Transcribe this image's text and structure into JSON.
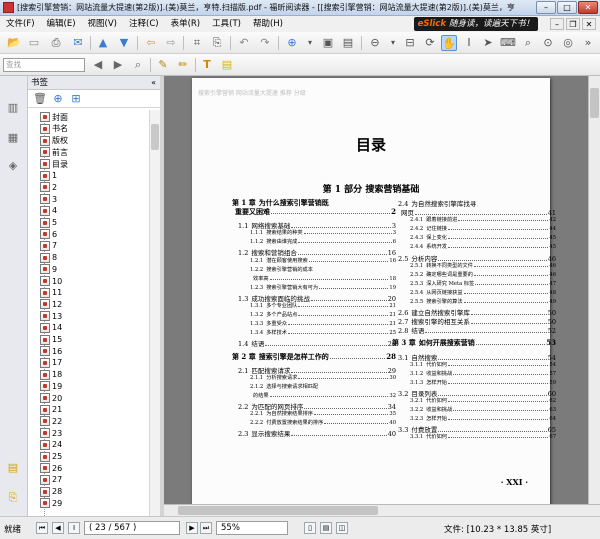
{
  "window": {
    "title": "[搜索引擎营销：网站流量大提速(第2版)].(美)莫兰，亨特.扫描版.pdf - 福昕阅读器 - [[搜索引擎营销：网站流量大提速(第2版)].(美)莫兰，亨",
    "minimize": "–",
    "maximize": "□",
    "close": "✕"
  },
  "menu": {
    "items": [
      "文件(F)",
      "编辑(E)",
      "视图(V)",
      "注释(C)",
      "表单(R)",
      "工具(T)",
      "帮助(H)"
    ],
    "promo_brand": "eSlick",
    "promo_text": "随身读，读遍天下书！"
  },
  "toolbar2": {
    "search_placeholder": "查找"
  },
  "panel": {
    "title": "书签",
    "collapse": "«",
    "bookmarks": [
      "封面",
      "书名",
      "版权",
      "前言",
      "目录",
      "1",
      "2",
      "3",
      "4",
      "5",
      "6",
      "7",
      "8",
      "9",
      "10",
      "11",
      "12",
      "13",
      "14",
      "15",
      "16",
      "17",
      "18",
      "19",
      "20",
      "21",
      "22",
      "23",
      "24",
      "25",
      "26",
      "27",
      "28",
      "29"
    ]
  },
  "document": {
    "bleed_text": "搜索引擎营销    网站流量大提速              推荐    分级",
    "toc_title": "目录",
    "part_title": "第 1 部分    搜索营销基础",
    "page_number": "· XXI ·",
    "left_column": [
      {
        "lv": 1,
        "num": "第 1 章",
        "text": "为什么搜索引擎营销既",
        "page": ""
      },
      {
        "lv": 1,
        "num": "",
        "text": "重要又困难",
        "page": "2"
      },
      {
        "lv": 0
      },
      {
        "lv": 2,
        "num": "1.1",
        "text": "网络搜索基础",
        "page": "3"
      },
      {
        "lv": 3,
        "num": "1.1.1",
        "text": "搜索结果的种类",
        "page": "3"
      },
      {
        "lv": 3,
        "num": "1.1.2",
        "text": "搜索由谁完成",
        "page": "6"
      },
      {
        "lv": 2,
        "num": "1.2",
        "text": "搜索和营销组合",
        "page": "16"
      },
      {
        "lv": 3,
        "num": "1.2.1",
        "text": "潜在顾客使用搜索",
        "page": "16"
      },
      {
        "lv": 3,
        "num": "1.2.2",
        "text": "搜索引擎营销的成本",
        "page": ""
      },
      {
        "lv": 3,
        "num": "",
        "text": "效率高",
        "page": "18"
      },
      {
        "lv": 3,
        "num": "1.2.3",
        "text": "搜索引擎营销大有可为",
        "page": "19"
      },
      {
        "lv": 2,
        "num": "1.3",
        "text": "成功搜索面临的挑战",
        "page": "20"
      },
      {
        "lv": 3,
        "num": "1.3.1",
        "text": "多个专业团队",
        "page": "21"
      },
      {
        "lv": 3,
        "num": "1.3.2",
        "text": "多个产品站点",
        "page": "21"
      },
      {
        "lv": 3,
        "num": "1.3.3",
        "text": "多重受众",
        "page": "21"
      },
      {
        "lv": 3,
        "num": "1.3.4",
        "text": "多样技术",
        "page": "25"
      },
      {
        "lv": 2,
        "num": "1.4",
        "text": "结语",
        "page": "26"
      },
      {
        "lv": 0
      },
      {
        "lv": 1,
        "num": "第 2 章",
        "text": "搜索引擎是怎样工作的",
        "page": "28"
      },
      {
        "lv": 0
      },
      {
        "lv": 2,
        "num": "2.1",
        "text": "匹配搜索请求",
        "page": "29"
      },
      {
        "lv": 3,
        "num": "2.1.1",
        "text": "分析搜索请求",
        "page": "30"
      },
      {
        "lv": 3,
        "num": "2.1.2",
        "text": "选择与搜索请求相匹配",
        "page": ""
      },
      {
        "lv": 3,
        "num": "",
        "text": "的结果",
        "page": "32"
      },
      {
        "lv": 2,
        "num": "2.2",
        "text": "为匹配的网页排序",
        "page": "34"
      },
      {
        "lv": 3,
        "num": "2.2.1",
        "text": "为自然搜索结果排序",
        "page": "35"
      },
      {
        "lv": 3,
        "num": "2.2.2",
        "text": "付费放置搜索结果的排序",
        "page": "40"
      },
      {
        "lv": 2,
        "num": "2.3",
        "text": "显示搜索结果",
        "page": "40"
      }
    ],
    "right_column": [
      {
        "lv": 2,
        "num": "2.4",
        "text": "为自然搜索引擎库找寻",
        "page": ""
      },
      {
        "lv": 2,
        "num": "",
        "text": "网页",
        "page": "41"
      },
      {
        "lv": 3,
        "num": "2.4.1",
        "text": "跟着链接前进",
        "page": "42"
      },
      {
        "lv": 3,
        "num": "2.4.2",
        "text": "记住链接",
        "page": "44"
      },
      {
        "lv": 3,
        "num": "2.4.3",
        "text": "保上变化",
        "page": "45"
      },
      {
        "lv": 3,
        "num": "2.4.4",
        "text": "系统开发",
        "page": "45"
      },
      {
        "lv": 2,
        "num": "2.5",
        "text": "分析内容",
        "page": "46"
      },
      {
        "lv": 3,
        "num": "2.5.1",
        "text": "转换不同类型的文件",
        "page": "46"
      },
      {
        "lv": 3,
        "num": "2.5.2",
        "text": "确定哪些词是重要的",
        "page": "46"
      },
      {
        "lv": 3,
        "num": "2.5.3",
        "text": "深入研究 Meta 标签",
        "page": "47"
      },
      {
        "lv": 3,
        "num": "2.5.4",
        "text": "从网页链接获益",
        "page": "48"
      },
      {
        "lv": 3,
        "num": "2.5.5",
        "text": "搜索引擎的算法",
        "page": "49"
      },
      {
        "lv": 2,
        "num": "2.6",
        "text": "建立自然搜索引擎库",
        "page": "50"
      },
      {
        "lv": 2,
        "num": "2.7",
        "text": "搜索引擎的相互关系",
        "page": "50"
      },
      {
        "lv": 2,
        "num": "2.8",
        "text": "结语",
        "page": "52"
      },
      {
        "lv": 0
      },
      {
        "lv": 1,
        "num": "第 3 章",
        "text": "如何开展搜索营销",
        "page": "53"
      },
      {
        "lv": 0
      },
      {
        "lv": 2,
        "num": "3.1",
        "text": "自然搜索",
        "page": "54"
      },
      {
        "lv": 3,
        "num": "3.1.1",
        "text": "代价如何",
        "page": "54"
      },
      {
        "lv": 3,
        "num": "3.1.2",
        "text": "收益和挑战",
        "page": "57"
      },
      {
        "lv": 3,
        "num": "3.1.3",
        "text": "怎样开始",
        "page": "59"
      },
      {
        "lv": 2,
        "num": "3.2",
        "text": "目录列表",
        "page": "60"
      },
      {
        "lv": 3,
        "num": "3.2.1",
        "text": "代价如何",
        "page": "62"
      },
      {
        "lv": 3,
        "num": "3.2.2",
        "text": "收益和挑战",
        "page": "63"
      },
      {
        "lv": 3,
        "num": "3.2.3",
        "text": "怎样开始",
        "page": "64"
      },
      {
        "lv": 2,
        "num": "3.3",
        "text": "付费放置",
        "page": "65"
      },
      {
        "lv": 3,
        "num": "3.3.1",
        "text": "代价如何",
        "page": "67"
      }
    ]
  },
  "status": {
    "ready": "就绪",
    "page_indicator": "( 23 / 567 )",
    "zoom": "55%",
    "doc_size": "文件: [10.23 * 13.85 英寸]"
  }
}
